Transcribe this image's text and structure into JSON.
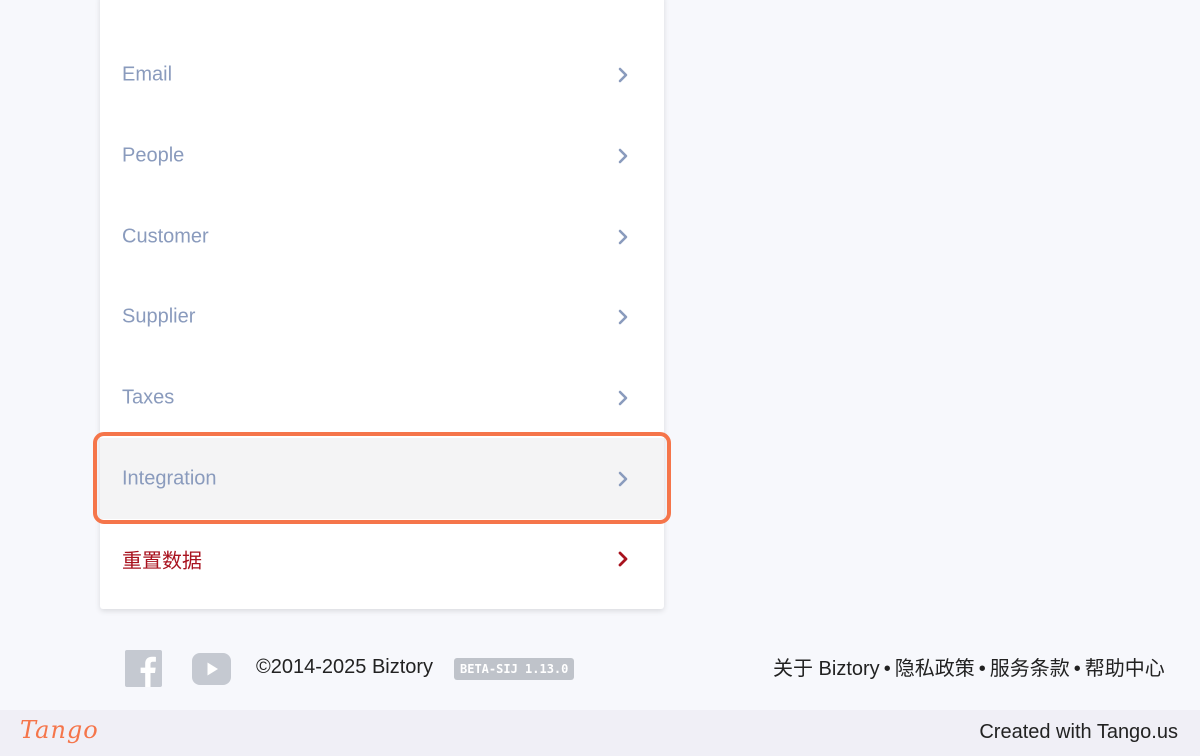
{
  "menu": {
    "items": [
      {
        "label": "Email"
      },
      {
        "label": "People"
      },
      {
        "label": "Customer"
      },
      {
        "label": "Supplier"
      },
      {
        "label": "Taxes"
      },
      {
        "label": "Integration"
      },
      {
        "label": "重置数据"
      }
    ],
    "chevron_icon": "chevron-right-icon",
    "colors": {
      "label": "#8a9bbd",
      "danger": "#a8121e",
      "chevron": "#8a9bbd",
      "highlight_ring": "#f5754a"
    }
  },
  "footer": {
    "copyright": "©2014-2025 Biztory",
    "version_badge": "BETA-SIJ 1.13.0",
    "links": [
      "关于 Biztory",
      "隐私政策",
      "服务条款",
      "帮助中心"
    ],
    "separator": "•",
    "social_icons": [
      "facebook-icon",
      "youtube-icon"
    ]
  },
  "tango": {
    "logo": "Tango",
    "credit": "Created with Tango.us"
  }
}
